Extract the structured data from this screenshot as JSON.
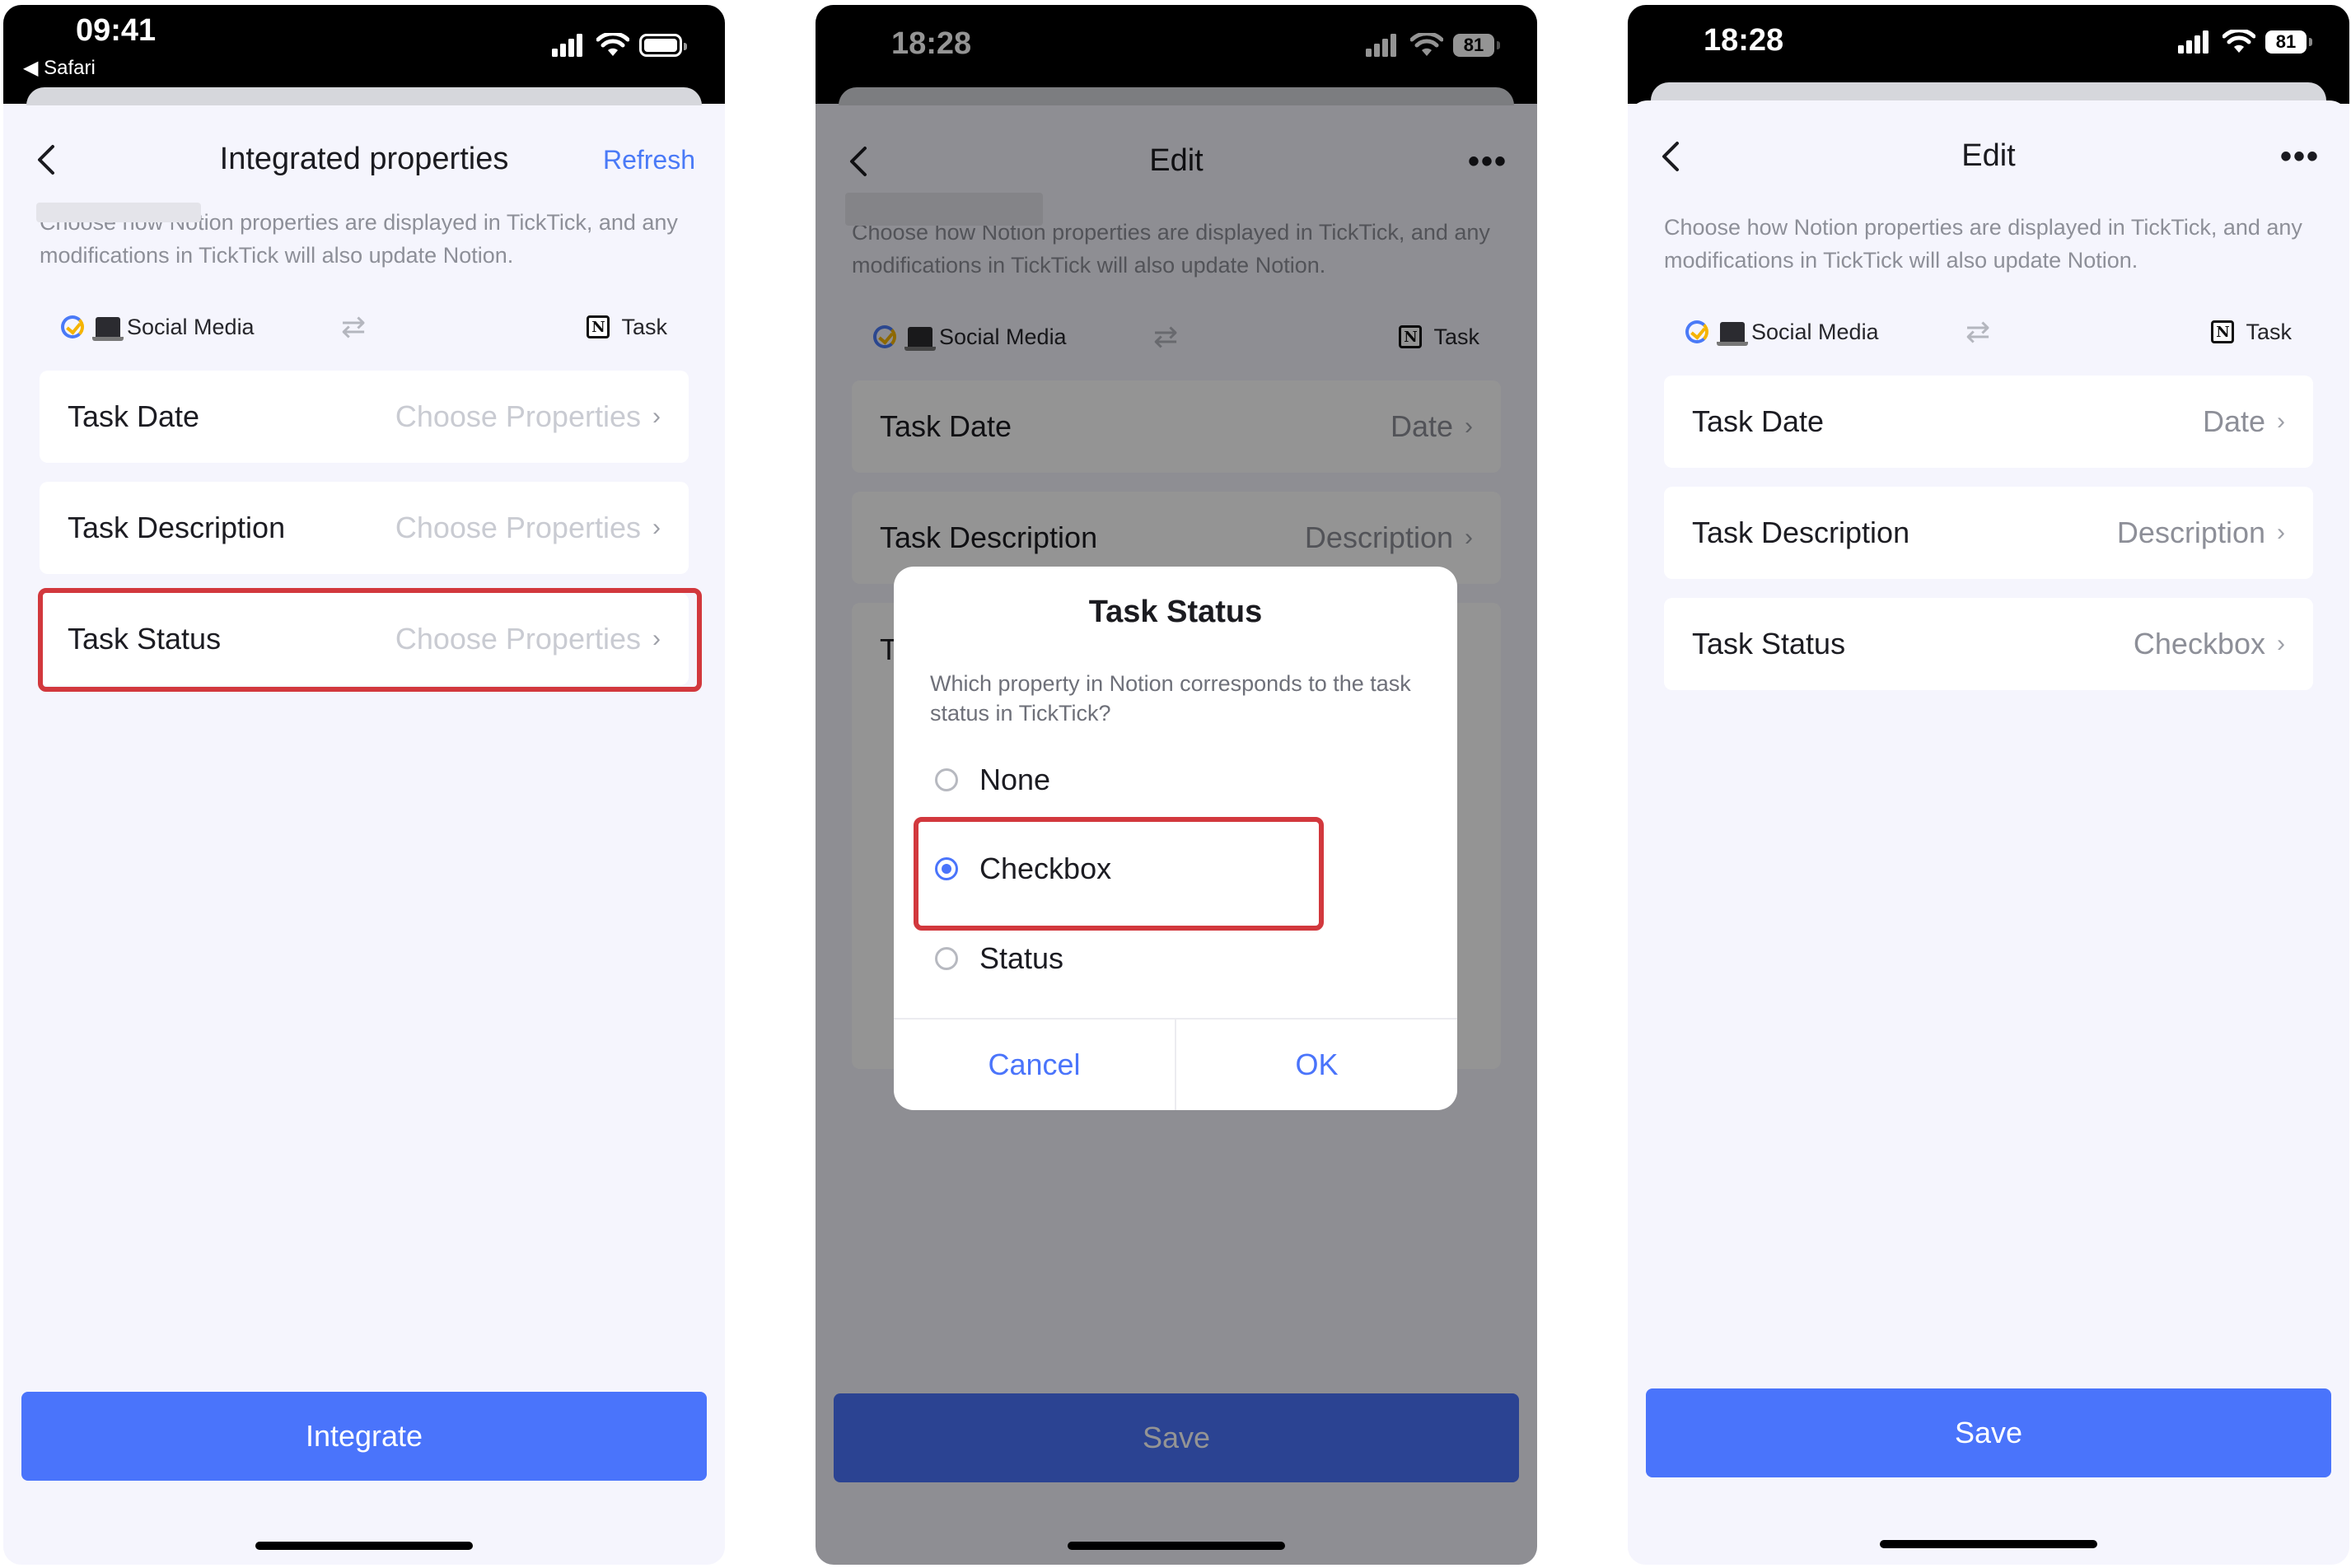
{
  "screen1": {
    "status": {
      "time": "09:41",
      "back_app": "◀ Safari"
    },
    "header": {
      "title": "Integrated properties",
      "refresh": "Refresh"
    },
    "description": "Choose how Notion properties are displayed in TickTick, and any modifications in TickTick will also update Notion.",
    "pair": {
      "left_label": "Social Media",
      "right_label": "Task"
    },
    "rows": [
      {
        "label": "Task Date",
        "value": "Choose Properties"
      },
      {
        "label": "Task Description",
        "value": "Choose Properties"
      },
      {
        "label": "Task Status",
        "value": "Choose Properties"
      }
    ],
    "primary_button": "Integrate"
  },
  "screen2": {
    "status": {
      "time": "18:28",
      "battery": "81"
    },
    "header": {
      "title": "Edit",
      "more": "•••"
    },
    "description": "Choose how Notion properties are displayed in TickTick, and any modifications in TickTick will also update Notion.",
    "pair": {
      "left_label": "Social Media",
      "right_label": "Task"
    },
    "rows": [
      {
        "label": "Task Date",
        "value": "Date"
      },
      {
        "label": "Task Description",
        "value": "Description"
      },
      {
        "label": "Ta",
        "value": ""
      }
    ],
    "primary_button": "Save",
    "dialog": {
      "title": "Task Status",
      "message": "Which property in Notion corresponds to the task status in TickTick?",
      "options": [
        "None",
        "Checkbox",
        "Status"
      ],
      "selected": "Checkbox",
      "cancel": "Cancel",
      "ok": "OK"
    }
  },
  "screen3": {
    "status": {
      "time": "18:28",
      "battery": "81"
    },
    "header": {
      "title": "Edit",
      "more": "•••"
    },
    "description": "Choose how Notion properties are displayed in TickTick, and any modifications in TickTick will also update Notion.",
    "pair": {
      "left_label": "Social Media",
      "right_label": "Task"
    },
    "rows": [
      {
        "label": "Task Date",
        "value": "Date"
      },
      {
        "label": "Task Description",
        "value": "Description"
      },
      {
        "label": "Task Status",
        "value": "Checkbox"
      }
    ],
    "primary_button": "Save"
  },
  "colors": {
    "accent": "#4a74fb",
    "highlight": "#d2383d",
    "background": "#f5f5fd"
  }
}
